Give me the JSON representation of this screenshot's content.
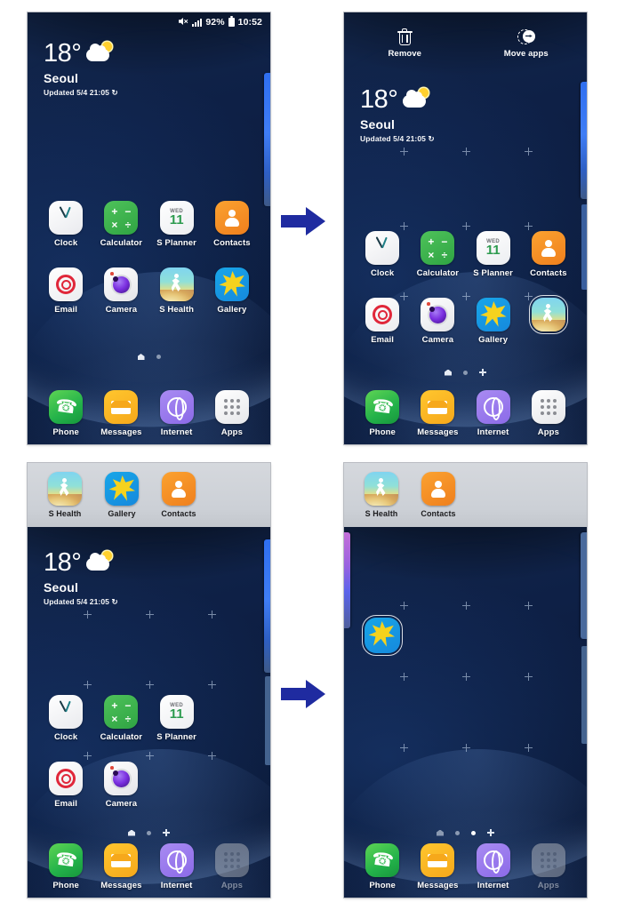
{
  "meta": {
    "title": "Samsung Galaxy home screen — move apps from Apps tray to Home screen"
  },
  "colors": {
    "arrow": "#1f2ba0",
    "wallpaper_navy": "#0d1f3c",
    "tray_grey": "#d5d8dd",
    "accent_green": "#2fa443",
    "accent_orange": "#ef7f1d"
  },
  "status_bar": {
    "mute_icon": "mute-icon",
    "signal_icon": "signal-bars-icon",
    "battery_percent": "92%",
    "battery_icon": "battery-icon",
    "time": "10:52"
  },
  "weather": {
    "temperature": "18°",
    "city": "Seoul",
    "updated": "Updated 5/4 21:05",
    "refresh_icon": "refresh-icon",
    "condition_icon": "partly-cloudy-icon"
  },
  "edit_bar": {
    "remove": {
      "label": "Remove",
      "icon": "trash-icon"
    },
    "move_apps": {
      "label": "Move apps",
      "icon": "move-apps-icon"
    }
  },
  "apps": {
    "clock": "Clock",
    "calculator": "Calculator",
    "splanner": "S Planner",
    "contacts": "Contacts",
    "email": "Email",
    "camera": "Camera",
    "shealth": "S Health",
    "gallery": "Gallery",
    "phone": "Phone",
    "messages": "Messages",
    "internet": "Internet",
    "apps": "Apps"
  },
  "calculator_symbols": {
    "plus": "+",
    "minus": "−",
    "times": "×",
    "divide": "÷"
  },
  "planner_icon": {
    "weekday": "WED",
    "day": "11"
  },
  "panels": [
    {
      "id": "panel-1",
      "name": "home-screen-normal",
      "mode": "normal",
      "page_indicator": {
        "dots": 2,
        "active": 0,
        "has_plus": false,
        "home_first": true
      },
      "rows": [
        [
          "clock",
          "calculator",
          "splanner",
          "contacts"
        ],
        [
          "email",
          "camera",
          "shealth",
          "gallery"
        ]
      ],
      "dock": [
        "phone",
        "messages",
        "internet",
        "apps"
      ]
    },
    {
      "id": "panel-2",
      "name": "home-screen-edit-mode-dragging-shealth",
      "mode": "edit",
      "page_indicator": {
        "dots": 2,
        "active": 0,
        "has_plus": true,
        "home_first": true
      },
      "rows": [
        [
          "clock",
          "calculator",
          "splanner",
          "contacts"
        ],
        [
          "email",
          "camera",
          "gallery",
          "shealth-dragging"
        ]
      ],
      "dock": [
        "phone",
        "messages",
        "internet",
        "apps"
      ]
    },
    {
      "id": "panel-3",
      "name": "apps-tray-open-over-home-screen",
      "mode": "tray",
      "tray": [
        "shealth",
        "gallery",
        "contacts"
      ],
      "page_indicator": {
        "dots": 2,
        "active": 0,
        "has_plus": true,
        "home_first": true
      },
      "rows": [
        [
          "clock",
          "calculator",
          "splanner"
        ],
        [
          "email",
          "camera"
        ]
      ],
      "dock": [
        "phone",
        "messages",
        "internet",
        "apps-dim"
      ]
    },
    {
      "id": "panel-4",
      "name": "dropping-gallery-on-empty-page",
      "mode": "tray",
      "tray": [
        "shealth",
        "contacts"
      ],
      "page_indicator": {
        "dots": 3,
        "active": 2,
        "has_plus": true,
        "home_first": true
      },
      "dropped_app": "gallery",
      "dock": [
        "phone",
        "messages",
        "internet",
        "apps-dim"
      ]
    }
  ],
  "arrows": [
    {
      "name": "arrow-panel1-to-panel2",
      "direction": "right"
    },
    {
      "name": "arrow-panel3-to-panel4",
      "direction": "right"
    }
  ]
}
